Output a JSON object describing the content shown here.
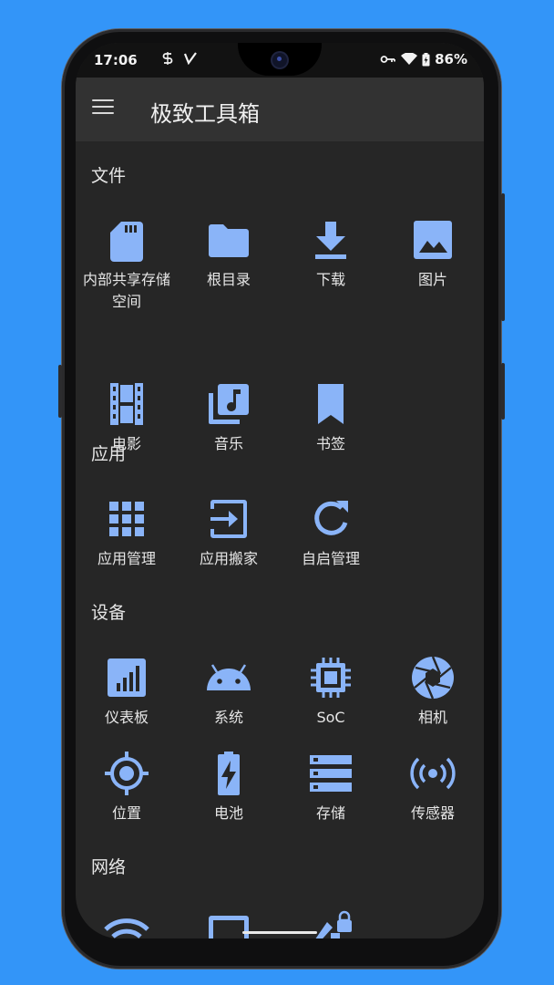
{
  "status": {
    "time": "17:06",
    "battery": "86%"
  },
  "app": {
    "title": "极致工具箱"
  },
  "colors": {
    "accent": "#8ab4f8",
    "background": "#262626",
    "appbar": "#323232",
    "page": "#3395f8"
  },
  "sections": [
    {
      "title": "文件",
      "items": [
        {
          "label": "内部共享存储空间",
          "icon": "sd-card-icon"
        },
        {
          "label": "根目录",
          "icon": "folder-icon"
        },
        {
          "label": "下载",
          "icon": "download-icon"
        },
        {
          "label": "图片",
          "icon": "image-icon"
        },
        {
          "label": "电影",
          "icon": "film-icon"
        },
        {
          "label": "音乐",
          "icon": "music-library-icon"
        },
        {
          "label": "书签",
          "icon": "bookmark-icon"
        }
      ]
    },
    {
      "title": "应用",
      "items": [
        {
          "label": "应用管理",
          "icon": "apps-grid-icon"
        },
        {
          "label": "应用搬家",
          "icon": "move-in-icon"
        },
        {
          "label": "自启管理",
          "icon": "refresh-icon"
        }
      ]
    },
    {
      "title": "设备",
      "items": [
        {
          "label": "仪表板",
          "icon": "dashboard-icon"
        },
        {
          "label": "系统",
          "icon": "android-icon"
        },
        {
          "label": "SoC",
          "icon": "chip-icon"
        },
        {
          "label": "相机",
          "icon": "camera-aperture-icon"
        },
        {
          "label": "位置",
          "icon": "location-crosshair-icon"
        },
        {
          "label": "电池",
          "icon": "battery-charging-icon"
        },
        {
          "label": "存储",
          "icon": "storage-icon"
        },
        {
          "label": "传感器",
          "icon": "sensor-icon"
        }
      ]
    },
    {
      "title": "网络",
      "items": [
        {
          "label": "",
          "icon": "wifi-icon"
        },
        {
          "label": "",
          "icon": "tablet-icon"
        },
        {
          "label": "",
          "icon": "ethernet-lock-icon"
        }
      ]
    }
  ]
}
